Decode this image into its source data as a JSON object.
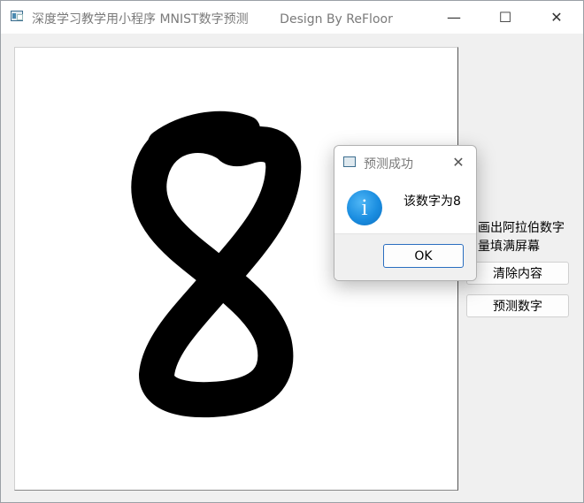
{
  "window": {
    "title": "深度学习教学用小程序 MNIST数字预测        Design By ReFloor",
    "minimize_glyph": "—",
    "maximize_glyph": "☐",
    "close_glyph": "✕"
  },
  "side_panel": {
    "instruction_line1": "画出阿拉伯数字",
    "instruction_line2": "量填满屏幕",
    "clear_button": "清除内容",
    "predict_button": "预测数字"
  },
  "dialog": {
    "title": "预测成功",
    "close_glyph": "✕",
    "icon": "information-icon",
    "icon_glyph": "i",
    "message": "该数字为8",
    "ok_label": "OK"
  },
  "colors": {
    "info_icon": "#1a8de0",
    "ok_border": "#2a6ec0",
    "stroke": "#000000"
  }
}
